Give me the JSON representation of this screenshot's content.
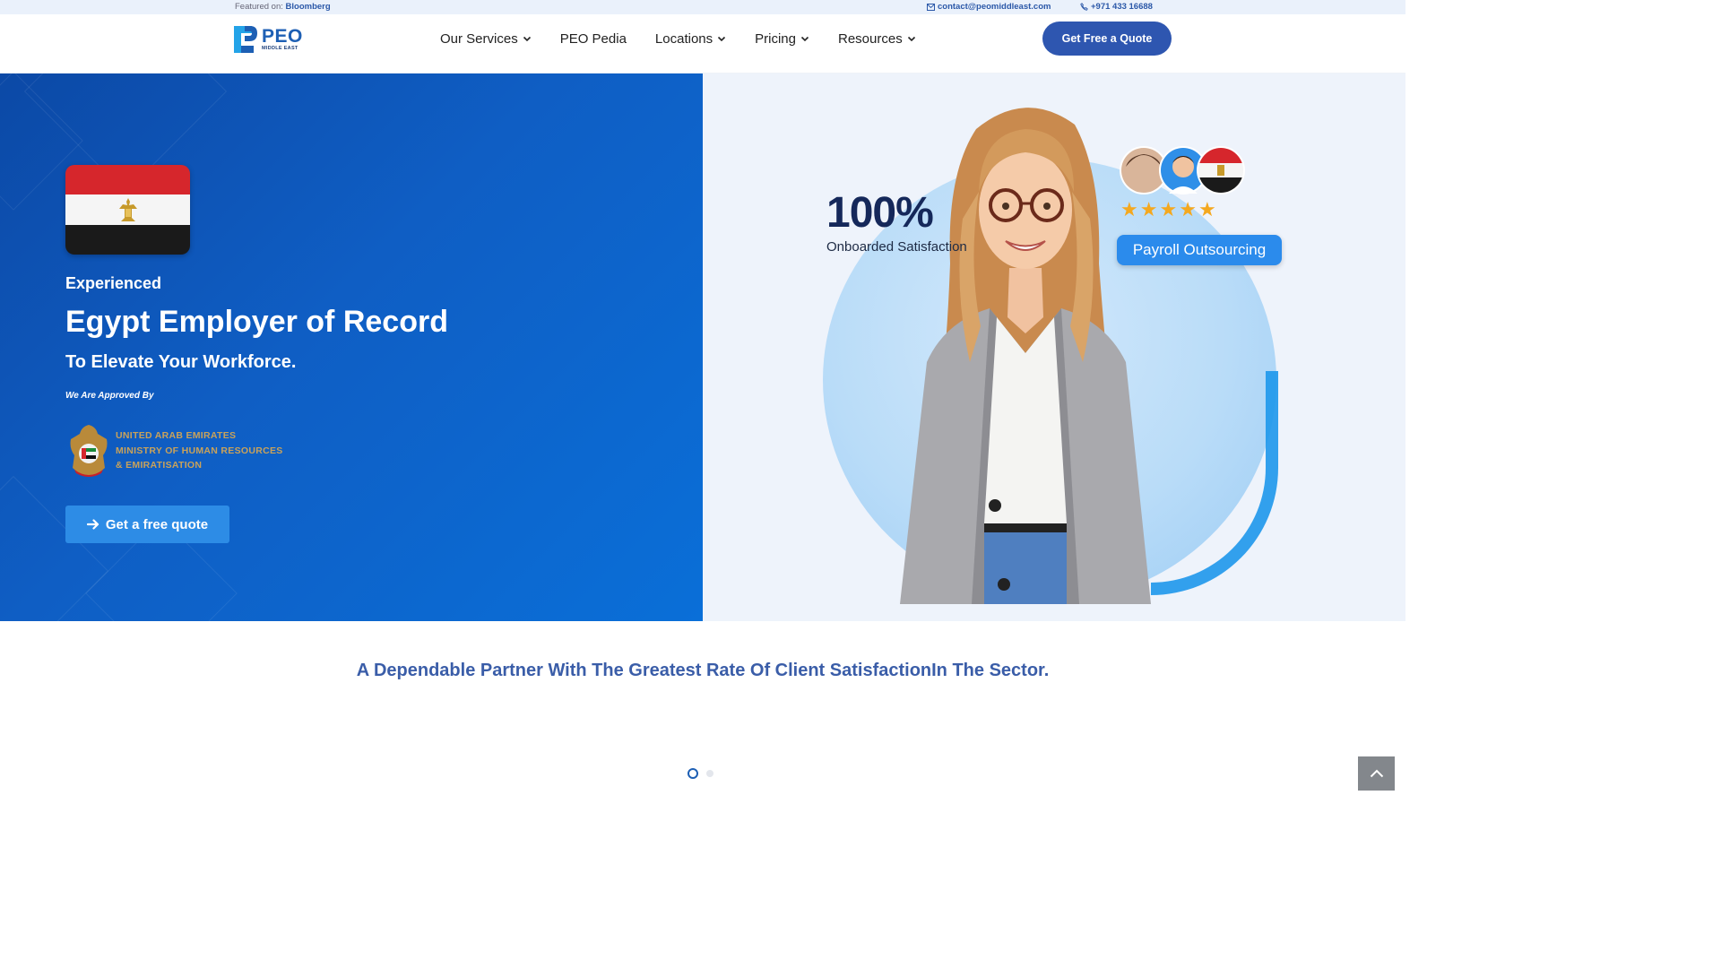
{
  "topbar": {
    "featured_prefix": "Featured on:",
    "featured_brand": "Bloomberg",
    "email": "contact@peomiddleast.com",
    "phone": "+971 433 16688"
  },
  "header": {
    "logo_main": "PEO",
    "logo_sub": "MIDDLE EAST",
    "nav": [
      {
        "label": "Our Services",
        "has_dropdown": true
      },
      {
        "label": "PEO Pedia",
        "has_dropdown": false
      },
      {
        "label": "Locations",
        "has_dropdown": true
      },
      {
        "label": "Pricing",
        "has_dropdown": true
      },
      {
        "label": "Resources",
        "has_dropdown": true
      }
    ],
    "cta_label": "Get Free a Quote"
  },
  "hero": {
    "eyebrow": "Experienced",
    "title": "Egypt Employer of Record",
    "subtitle": "To Elevate Your Workforce.",
    "approved_by": "We Are Approved By",
    "ministry_lines": [
      "UNITED ARAB EMIRATES",
      "MINISTRY OF HUMAN RESOURCES",
      "& EMIRATISATION"
    ],
    "cta_label": "Get a free quote",
    "stat_value": "100%",
    "stat_label": "Onboarded Satisfaction",
    "rating_stars": 5,
    "badge_label": "Payroll Outsourcing"
  },
  "tagline": "A Dependable Partner With The Greatest Rate Of Client SatisfactionIn The Sector.",
  "slider": {
    "total": 2,
    "active": 1
  },
  "colors": {
    "brand_blue": "#2e56b0",
    "hero_blue": "#0f5ec4",
    "accent_blue": "#2d8ce6",
    "tagline_blue": "#3a5da8",
    "gold": "#c9a25a",
    "star": "#f4a81f"
  },
  "icons": [
    "envelope-icon",
    "phone-icon",
    "chevron-down-icon",
    "arrow-right-icon",
    "chevron-up-icon",
    "star-icon"
  ]
}
